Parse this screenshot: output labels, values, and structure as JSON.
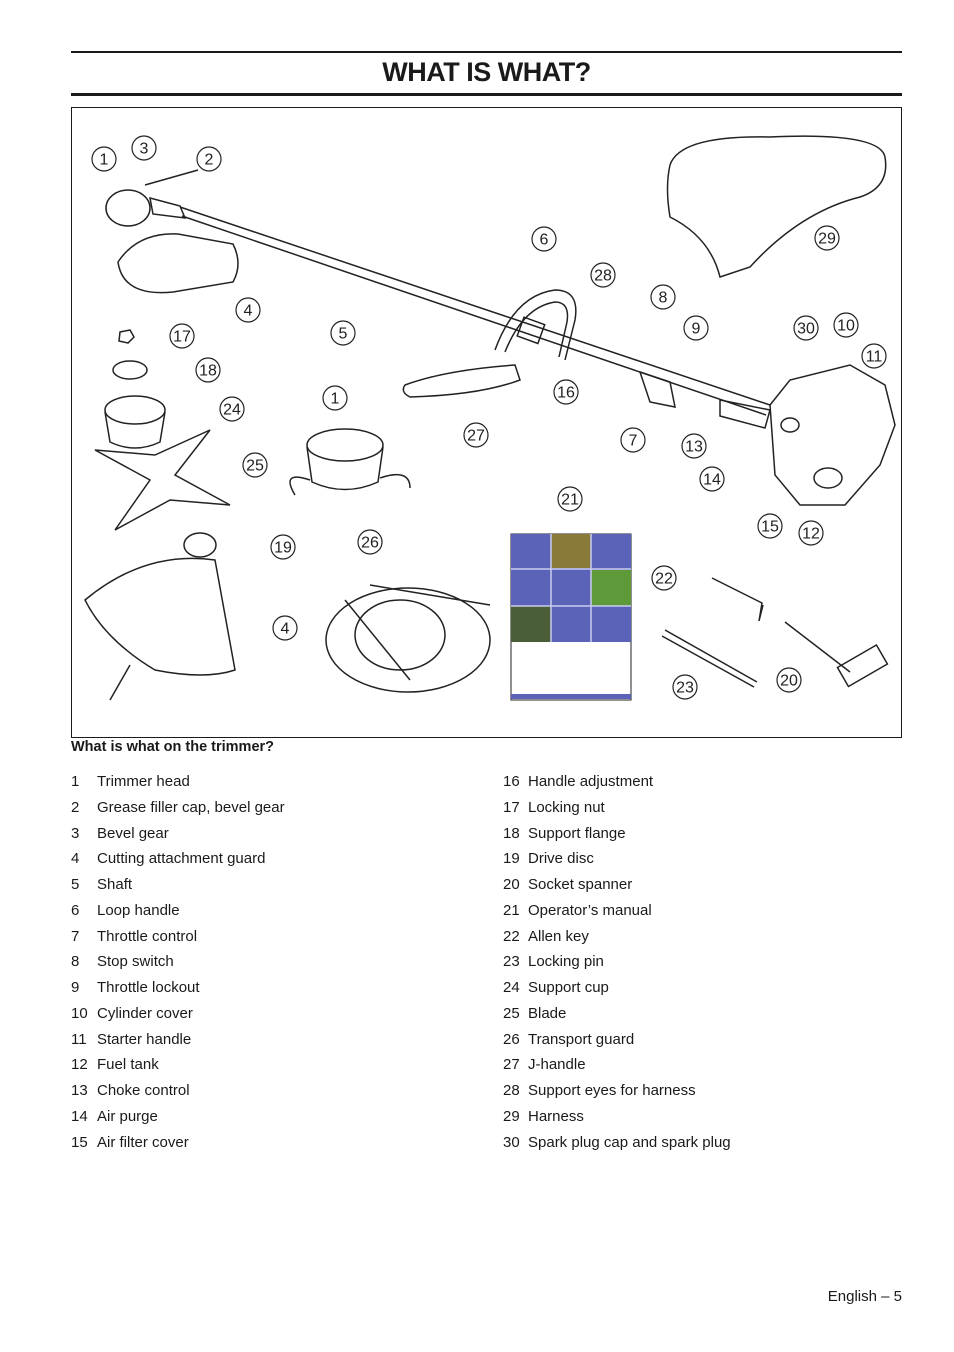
{
  "title": "WHAT IS WHAT?",
  "figure": {
    "callouts": [
      "1",
      "3",
      "2",
      "6",
      "29",
      "28",
      "8",
      "9",
      "30",
      "10",
      "11",
      "4",
      "5",
      "17",
      "18",
      "24",
      "1",
      "16",
      "27",
      "7",
      "13",
      "14",
      "25",
      "21",
      "15",
      "12",
      "19",
      "26",
      "22",
      "4",
      "23",
      "20"
    ],
    "manual_cover_color": "#5a63b8"
  },
  "caption": "What is what on the trimmer?",
  "parts_left": [
    {
      "num": "1",
      "label": "Trimmer head"
    },
    {
      "num": "2",
      "label": "Grease filler cap, bevel gear"
    },
    {
      "num": "3",
      "label": "Bevel gear"
    },
    {
      "num": "4",
      "label": "Cutting attachment guard"
    },
    {
      "num": "5",
      "label": "Shaft"
    },
    {
      "num": "6",
      "label": "Loop handle"
    },
    {
      "num": "7",
      "label": "Throttle control"
    },
    {
      "num": "8",
      "label": "Stop switch"
    },
    {
      "num": "9",
      "label": "Throttle lockout"
    },
    {
      "num": "10",
      "label": "Cylinder cover"
    },
    {
      "num": "11",
      "label": "Starter handle"
    },
    {
      "num": "12",
      "label": "Fuel tank"
    },
    {
      "num": "13",
      "label": "Choke control"
    },
    {
      "num": "14",
      "label": "Air purge"
    },
    {
      "num": "15",
      "label": "Air filter cover"
    }
  ],
  "parts_right": [
    {
      "num": "16",
      "label": "Handle adjustment"
    },
    {
      "num": "17",
      "label": "Locking nut"
    },
    {
      "num": "18",
      "label": "Support flange"
    },
    {
      "num": "19",
      "label": "Drive disc"
    },
    {
      "num": "20",
      "label": "Socket spanner"
    },
    {
      "num": "21",
      "label": "Operator’s manual"
    },
    {
      "num": "22",
      "label": "Allen key"
    },
    {
      "num": "23",
      "label": "Locking pin"
    },
    {
      "num": "24",
      "label": "Support cup"
    },
    {
      "num": "25",
      "label": "Blade"
    },
    {
      "num": "26",
      "label": "Transport guard"
    },
    {
      "num": "27",
      "label": "J-handle"
    },
    {
      "num": "28",
      "label": "Support eyes for harness"
    },
    {
      "num": "29",
      "label": "Harness"
    },
    {
      "num": "30",
      "label": "Spark plug cap and spark plug"
    }
  ],
  "footer": "English – 5"
}
